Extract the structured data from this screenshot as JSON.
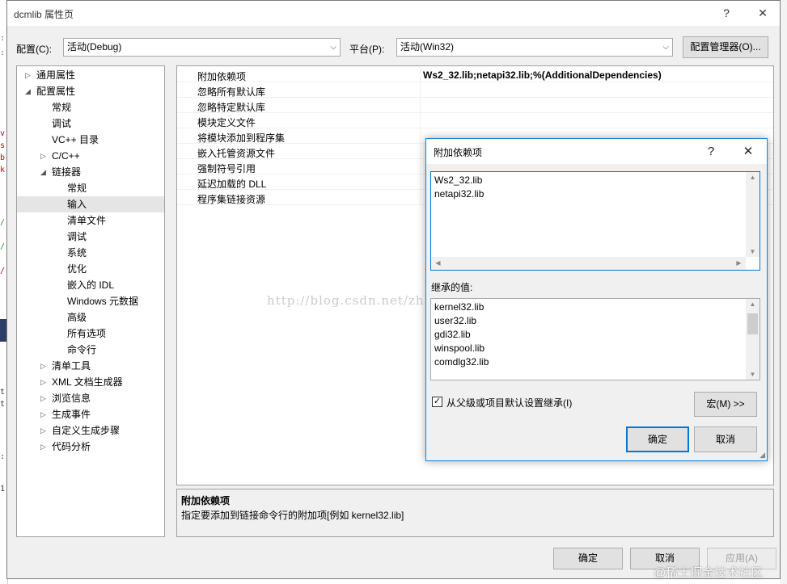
{
  "window": {
    "title": "dcmlib 属性页",
    "help_glyph": "?",
    "close_glyph": "✕"
  },
  "toolbar": {
    "config_label": "配置(C):",
    "config_value": "活动(Debug)",
    "platform_label": "平台(P):",
    "platform_value": "活动(Win32)",
    "config_manager_button": "配置管理器(O)..."
  },
  "tree": [
    {
      "label": "通用属性",
      "level": 0,
      "expander": "right"
    },
    {
      "label": "配置属性",
      "level": 0,
      "expander": "down"
    },
    {
      "label": "常规",
      "level": 1,
      "expander": ""
    },
    {
      "label": "调试",
      "level": 1,
      "expander": ""
    },
    {
      "label": "VC++ 目录",
      "level": 1,
      "expander": ""
    },
    {
      "label": "C/C++",
      "level": 1,
      "expander": "right"
    },
    {
      "label": "链接器",
      "level": 1,
      "expander": "down"
    },
    {
      "label": "常规",
      "level": 2,
      "expander": ""
    },
    {
      "label": "输入",
      "level": 2,
      "expander": "",
      "selected": true
    },
    {
      "label": "清单文件",
      "level": 2,
      "expander": ""
    },
    {
      "label": "调试",
      "level": 2,
      "expander": ""
    },
    {
      "label": "系统",
      "level": 2,
      "expander": ""
    },
    {
      "label": "优化",
      "level": 2,
      "expander": ""
    },
    {
      "label": "嵌入的 IDL",
      "level": 2,
      "expander": ""
    },
    {
      "label": "Windows 元数据",
      "level": 2,
      "expander": ""
    },
    {
      "label": "高级",
      "level": 2,
      "expander": ""
    },
    {
      "label": "所有选项",
      "level": 2,
      "expander": ""
    },
    {
      "label": "命令行",
      "level": 2,
      "expander": ""
    },
    {
      "label": "清单工具",
      "level": 1,
      "expander": "right"
    },
    {
      "label": "XML 文档生成器",
      "level": 1,
      "expander": "right"
    },
    {
      "label": "浏览信息",
      "level": 1,
      "expander": "right"
    },
    {
      "label": "生成事件",
      "level": 1,
      "expander": "right"
    },
    {
      "label": "自定义生成步骤",
      "level": 1,
      "expander": "right"
    },
    {
      "label": "代码分析",
      "level": 1,
      "expander": "right"
    }
  ],
  "properties": [
    {
      "name": "附加依赖项",
      "value": "Ws2_32.lib;netapi32.lib;%(AdditionalDependencies)"
    },
    {
      "name": "忽略所有默认库",
      "value": ""
    },
    {
      "name": "忽略特定默认库",
      "value": ""
    },
    {
      "name": "模块定义文件",
      "value": ""
    },
    {
      "name": "将模块添加到程序集",
      "value": ""
    },
    {
      "name": "嵌入托管资源文件",
      "value": ""
    },
    {
      "name": "强制符号引用",
      "value": ""
    },
    {
      "name": "延迟加载的 DLL",
      "value": ""
    },
    {
      "name": "程序集链接资源",
      "value": ""
    }
  ],
  "description": {
    "title": "附加依赖项",
    "text": "指定要添加到链接命令行的附加项[例如 kernel32.lib]"
  },
  "dialog": {
    "title": "附加依赖项",
    "help_glyph": "?",
    "close_glyph": "✕",
    "edit_lines": [
      "Ws2_32.lib",
      "netapi32.lib"
    ],
    "inherited_label": "继承的值:",
    "inherited_lines": [
      "kernel32.lib",
      "user32.lib",
      "gdi32.lib",
      "winspool.lib",
      "comdlg32.lib"
    ],
    "inherit_checkbox_label": "从父级或项目默认设置继承(I)",
    "inherit_checked": true,
    "macros_button": "宏(M) >>",
    "ok_button": "确定",
    "cancel_button": "取消"
  },
  "footer": {
    "ok_button": "确定",
    "cancel_button": "取消",
    "apply_button": "应用(A)"
  },
  "watermark": "http://blog.csdn.net/zh131421",
  "corner_watermark": "@稀土掘金技术社区",
  "icons": {
    "expander_right": "▷",
    "expander_down": "◢",
    "combo_arrow": "⌵",
    "check": "✓"
  }
}
